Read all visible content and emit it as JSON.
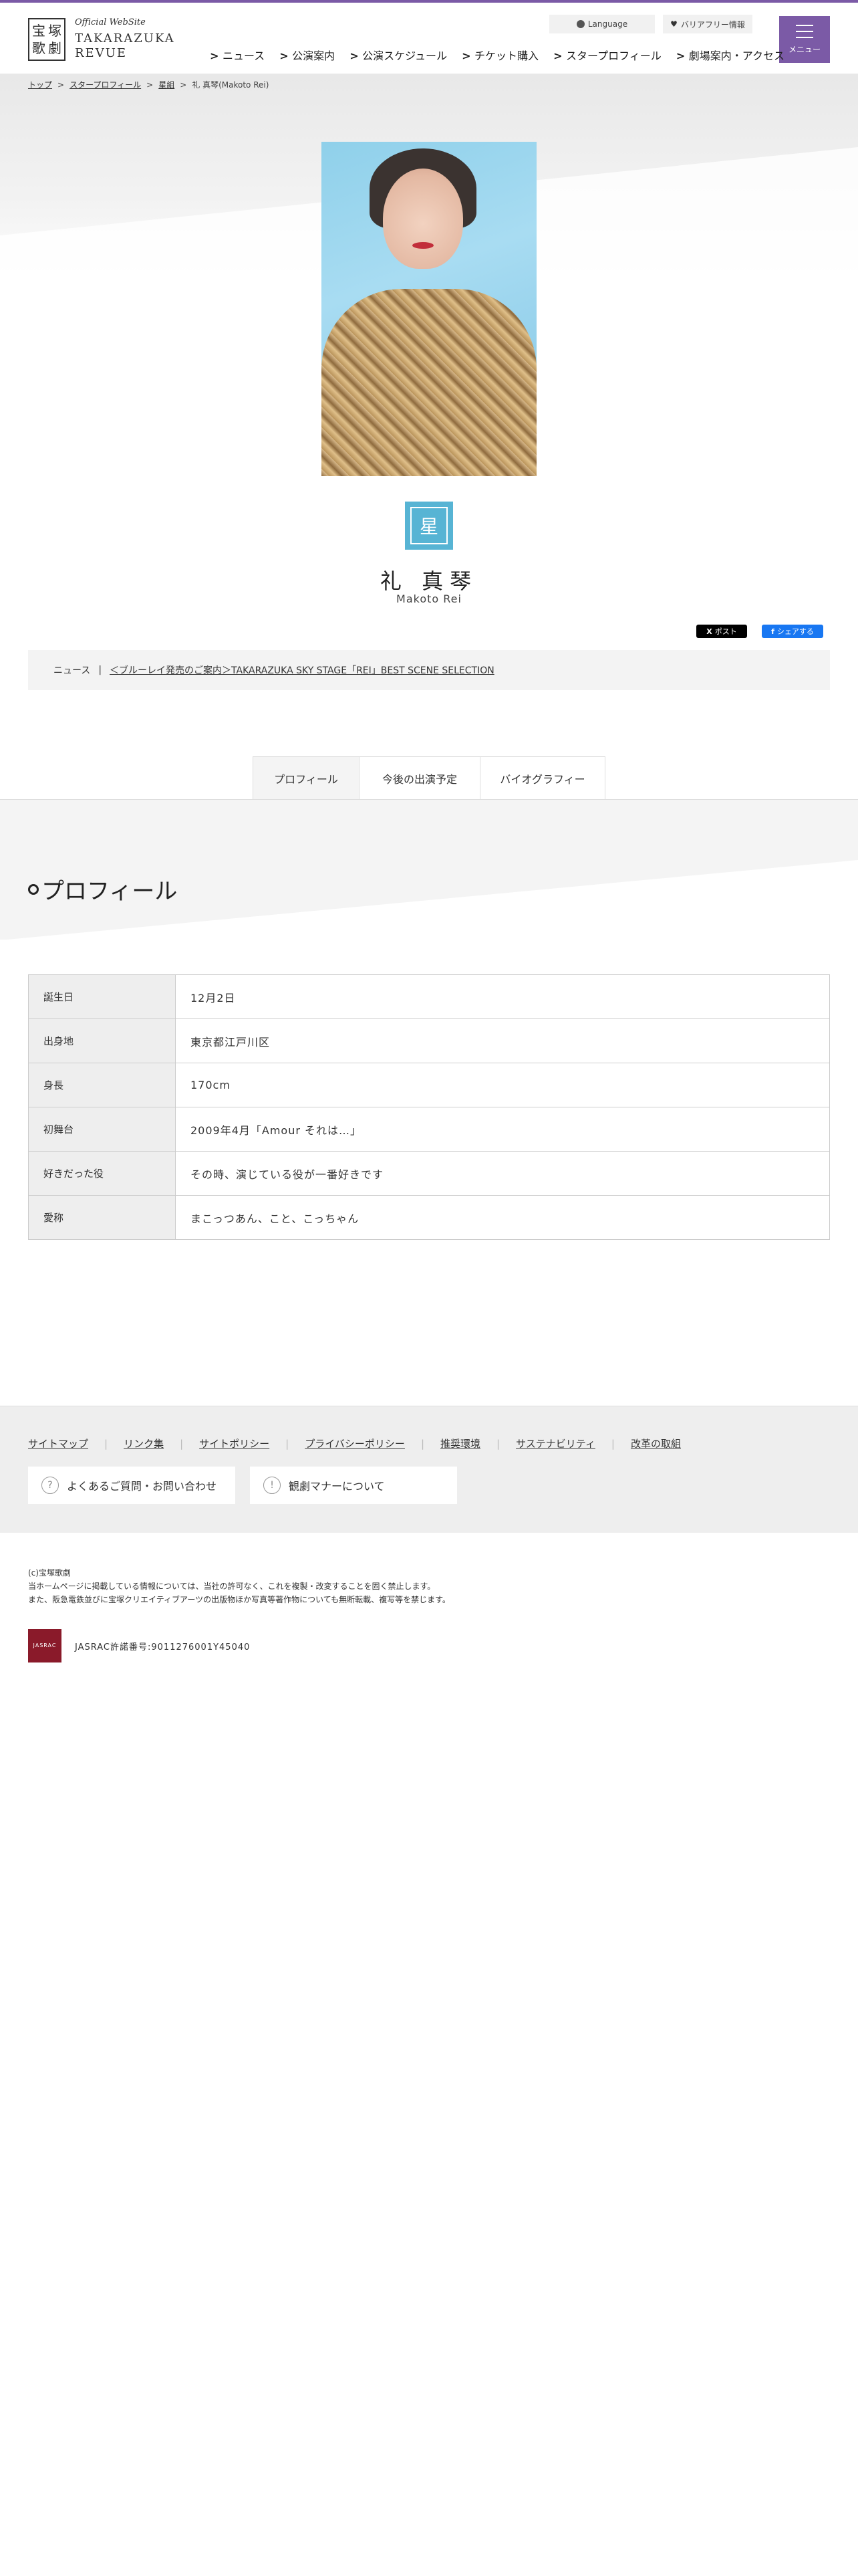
{
  "header": {
    "logo_kanji": [
      "宝",
      "塚",
      "歌",
      "劇"
    ],
    "logo_sub": "Official WebSite",
    "logo_main_1": "TAKARAZUKA",
    "logo_main_2": "REVUE",
    "language_label": "Language",
    "barrier_free_label": "バリアフリー情報",
    "menu_label": "メニュー",
    "nav": [
      "ニュース",
      "公演案内",
      "公演スケジュール",
      "チケット購入",
      "スタープロフィール",
      "劇場案内・アクセス"
    ]
  },
  "breadcrumb": [
    {
      "label": "トップ",
      "link": true
    },
    {
      "label": "スタープロフィール",
      "link": true
    },
    {
      "label": "星組",
      "link": true
    },
    {
      "label": "礼 真琴(Makoto Rei)",
      "link": false
    }
  ],
  "breadcrumb_sep": ">",
  "profile": {
    "troupe_glyph": "星",
    "name": "礼 真琴",
    "name_roman": "Makoto Rei"
  },
  "share": {
    "x_label": "ポスト",
    "fb_label": "シェアする"
  },
  "news": {
    "label": "ニュース",
    "sep": "|",
    "link": "＜ブルーレイ発売のご案内＞TAKARAZUKA SKY STAGE「REI」BEST SCENE SELECTION"
  },
  "tabs": [
    "プロフィール",
    "今後の出演予定",
    "バイオグラフィー"
  ],
  "section_title": "プロフィール",
  "profile_table": [
    {
      "key": "誕生日",
      "value": "12月2日"
    },
    {
      "key": "出身地",
      "value": "東京都江戸川区"
    },
    {
      "key": "身長",
      "value": "170cm"
    },
    {
      "key": "初舞台",
      "value": "2009年4月「Amour それは…」"
    },
    {
      "key": "好きだった役",
      "value": "その時、演じている役が一番好きです"
    },
    {
      "key": "愛称",
      "value": "まこっつあん、こと、こっちゃん"
    }
  ],
  "footer": {
    "links": [
      "サイトマップ",
      "リンク集",
      "サイトポリシー",
      "プライバシーポリシー",
      "推奨環境",
      "サステナビリティ",
      "改革の取組"
    ],
    "buttons": [
      {
        "icon": "?",
        "label": "よくあるご質問・お問い合わせ"
      },
      {
        "icon": "!",
        "label": "観劇マナーについて"
      }
    ],
    "copyright": "(c)宝塚歌劇",
    "notice_1": "当ホームページに掲載している情報については、当社の許可なく、これを複製・改変することを固く禁止します。",
    "notice_2": "また、阪急電鉄並びに宝塚クリエイティブアーツの出版物ほか写真等著作物についても無断転載、複写等を禁じます。",
    "jasrac_mark": "JASRAC",
    "jasrac": "JASRAC許諾番号:9011276001Y45040"
  },
  "colors": {
    "accent": "#7b5aa6",
    "troupe": "#57b4d4",
    "fb": "#1877f2"
  }
}
